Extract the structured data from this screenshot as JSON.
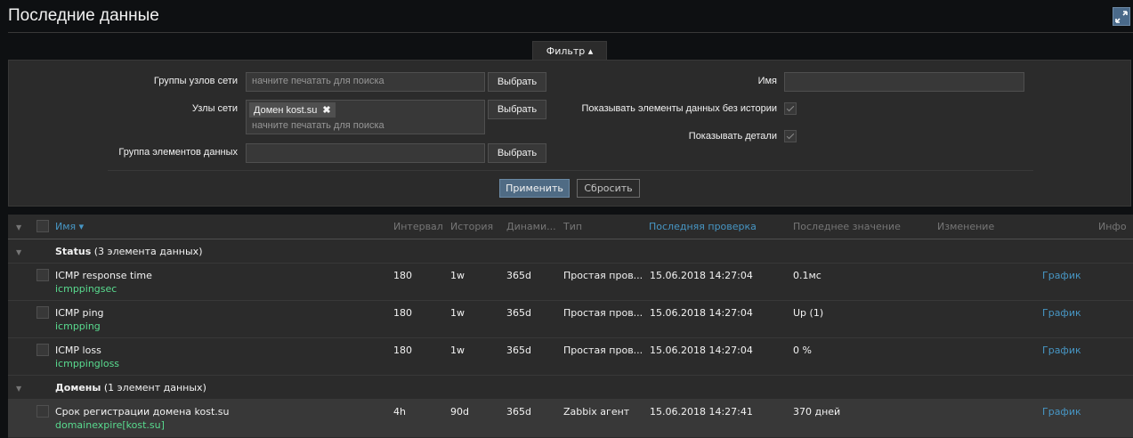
{
  "page": {
    "title": "Последние данные"
  },
  "filter": {
    "tab_label": "Фильтр ▴",
    "host_groups_label": "Группы узлов сети",
    "host_groups_placeholder": "начните печатать для поиска",
    "hosts_label": "Узлы сети",
    "hosts_chip": "Домен kost.su",
    "hosts_placeholder": "начните печатать для поиска",
    "app_label": "Группа элементов данных",
    "select_label": "Выбрать",
    "name_label": "Имя",
    "show_without_data_label": "Показывать элементы данных без истории",
    "show_details_label": "Показывать детали",
    "apply_label": "Применить",
    "reset_label": "Сбросить"
  },
  "table": {
    "headers": {
      "name": "Имя ▾",
      "interval": "Интервал",
      "history": "История",
      "trends": "Динами...",
      "type": "Тип",
      "last_check": "Последняя проверка",
      "last_value": "Последнее значение",
      "change": "Изменение",
      "info": "Инфо"
    },
    "groups": [
      {
        "name": "Status",
        "count": " (3 элемента данных)",
        "rows": [
          {
            "name": "ICMP response time",
            "key": "icmppingsec",
            "interval": "180",
            "history": "1w",
            "trends": "365d",
            "type": "Простая пров...",
            "last_check": "15.06.2018 14:27:04",
            "last_value": "0.1мс",
            "link": "График"
          },
          {
            "name": "ICMP ping",
            "key": "icmpping",
            "interval": "180",
            "history": "1w",
            "trends": "365d",
            "type": "Простая пров...",
            "last_check": "15.06.2018 14:27:04",
            "last_value": "Up (1)",
            "link": "График"
          },
          {
            "name": "ICMP loss",
            "key": "icmppingloss",
            "interval": "180",
            "history": "1w",
            "trends": "365d",
            "type": "Простая пров...",
            "last_check": "15.06.2018 14:27:04",
            "last_value": "0 %",
            "link": "График"
          }
        ]
      },
      {
        "name": "Домены",
        "count": " (1 элемент данных)",
        "rows": [
          {
            "name": "Срок регистрации домена kost.su",
            "key": "domainexpire[kost.su]",
            "interval": "4h",
            "history": "90d",
            "trends": "365d",
            "type": "Zabbix агент",
            "last_check": "15.06.2018 14:27:41",
            "last_value": "370 дней",
            "link": "График"
          }
        ]
      }
    ]
  }
}
